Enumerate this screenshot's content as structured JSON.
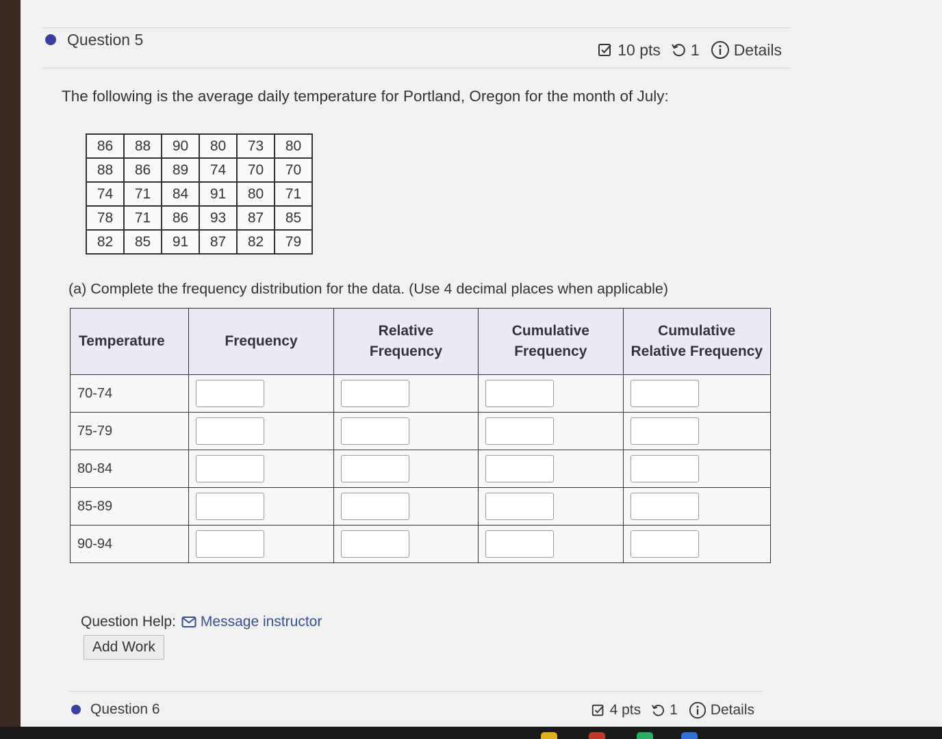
{
  "question5": {
    "title": "Question 5",
    "points": "10 pts",
    "attempts": "1",
    "details": "Details",
    "prompt": "The following is the average daily temperature for Portland, Oregon for the month of July:",
    "data_rows": [
      [
        "86",
        "88",
        "90",
        "80",
        "73",
        "80"
      ],
      [
        "88",
        "86",
        "89",
        "74",
        "70",
        "70"
      ],
      [
        "74",
        "71",
        "84",
        "91",
        "80",
        "71"
      ],
      [
        "78",
        "71",
        "86",
        "93",
        "87",
        "85"
      ],
      [
        "82",
        "85",
        "91",
        "87",
        "82",
        "79"
      ]
    ],
    "part_a": "(a) Complete the frequency distribution for the data. (Use 4 decimal places when applicable)",
    "table_headers": [
      "Temperature",
      "Frequency",
      "Relative Frequency",
      "Cumulative Frequency",
      "Cumulative Relative Frequency"
    ],
    "classes": [
      "70-74",
      "75-79",
      "80-84",
      "85-89",
      "90-94"
    ],
    "help_label": "Question Help:",
    "message_link": "Message instructor",
    "add_work": "Add Work"
  },
  "question6": {
    "title": "Question 6",
    "points": "4 pts",
    "attempts": "1",
    "details": "Details"
  },
  "colors": {
    "accent_dot": "#3a3f9e",
    "header_bg": "#e9eaf6",
    "link": "#3a4f8a"
  }
}
